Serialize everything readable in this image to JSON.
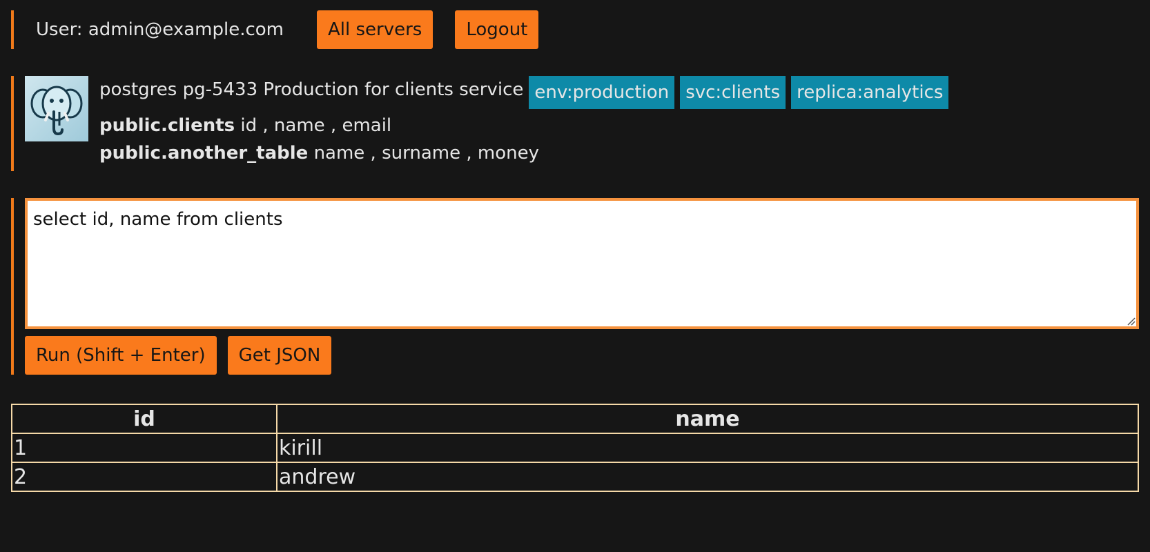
{
  "header": {
    "user_label": "User: admin@example.com",
    "all_servers_label": "All servers",
    "logout_label": "Logout"
  },
  "server": {
    "logo_icon": "postgres-elephant-icon",
    "title": "postgres pg-5433 Production for clients service",
    "tags": [
      "env:production",
      "svc:clients",
      "replica:analytics"
    ],
    "tables": [
      {
        "name": "public.clients",
        "columns": "id , name , email"
      },
      {
        "name": "public.another_table",
        "columns": "name , surname , money"
      }
    ]
  },
  "query": {
    "text": "select id, name from clients",
    "run_label": "Run (Shift + Enter)",
    "json_label": "Get JSON"
  },
  "results": {
    "columns": [
      "id",
      "name"
    ],
    "rows": [
      [
        "1",
        "kirill"
      ],
      [
        "2",
        "andrew"
      ]
    ]
  },
  "colors": {
    "accent": "#fa7a1c",
    "tag": "#0e8aa8",
    "background": "#161616",
    "table_border": "#f5d9a8"
  }
}
